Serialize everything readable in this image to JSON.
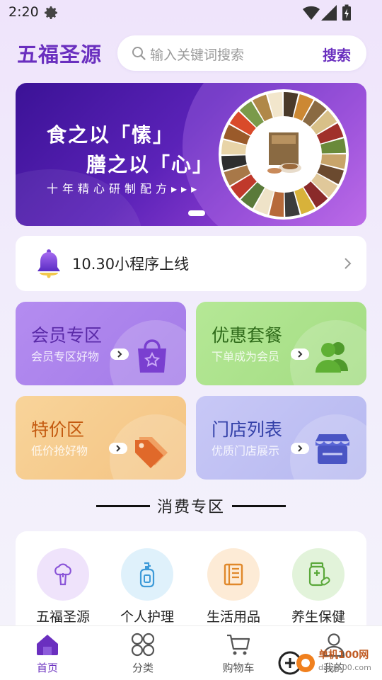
{
  "status_bar": {
    "time": "2:20"
  },
  "header": {
    "brand": "五福圣源",
    "search_placeholder": "输入关键词搜索",
    "search_button": "搜索"
  },
  "banner": {
    "line1": "食之以「愫」",
    "line2": "膳之以「心」",
    "line3": "十年精心研制配方▸▸▸"
  },
  "notice": {
    "text": "10.30小程序上线"
  },
  "cards": [
    {
      "title": "会员专区",
      "subtitle": "会员专区好物",
      "icon": "shopping-bag-icon"
    },
    {
      "title": "优惠套餐",
      "subtitle": "下单成为会员",
      "icon": "people-icon"
    },
    {
      "title": "特价区",
      "subtitle": "低价抢好物",
      "icon": "price-tag-icon"
    },
    {
      "title": "门店列表",
      "subtitle": "优质门店展示",
      "icon": "store-icon"
    }
  ],
  "section": {
    "title": "消费专区"
  },
  "categories": [
    {
      "label": "五福圣源",
      "icon": "broccoli-icon",
      "color": "#efe3fb"
    },
    {
      "label": "个人护理",
      "icon": "lotion-bottle-icon",
      "color": "#dff1fb"
    },
    {
      "label": "生活用品",
      "icon": "book-icon",
      "color": "#fdebd6"
    },
    {
      "label": "养生保健",
      "icon": "supplement-jar-icon",
      "color": "#e2f3da"
    }
  ],
  "tabs": [
    {
      "label": "首页",
      "icon": "home-icon",
      "active": true
    },
    {
      "label": "分类",
      "icon": "grid-icon",
      "active": false
    },
    {
      "label": "购物车",
      "icon": "cart-icon",
      "active": false
    },
    {
      "label": "我的",
      "icon": "user-icon",
      "active": false
    }
  ],
  "watermark": {
    "text": "单机100网",
    "url": "danji100.com"
  },
  "colors": {
    "accent": "#6a2fbf",
    "banner": "#5b22b8"
  }
}
